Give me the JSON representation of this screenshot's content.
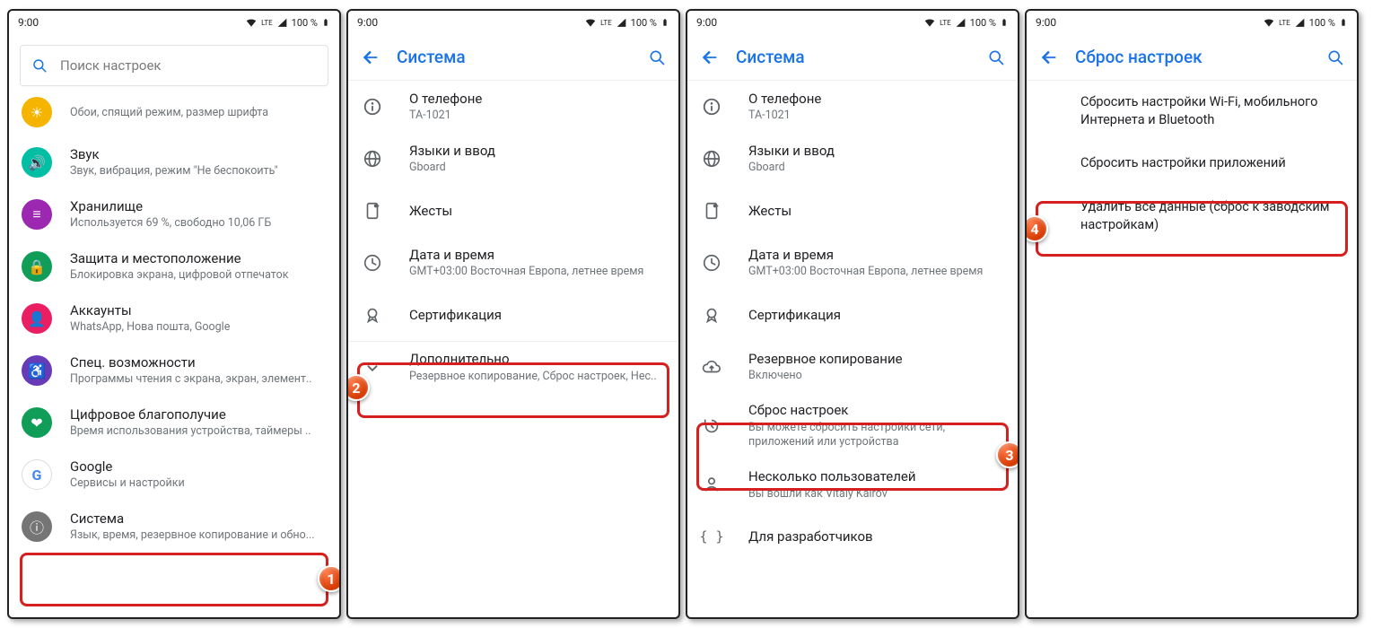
{
  "status": {
    "time": "9:00",
    "lte": "LTE",
    "battery": "100 %"
  },
  "screen1": {
    "search_placeholder": "Поиск настроек",
    "display": {
      "sub": "Обои, спящий режим, размер шрифта"
    },
    "sound": {
      "title": "Звук",
      "sub": "Звук, вибрация, режим \"Не беспокоить\""
    },
    "storage": {
      "title": "Хранилище",
      "sub": "Используется 69 %, свободно 10,06 ГБ"
    },
    "security": {
      "title": "Защита и местоположение",
      "sub": "Блокировка экрана, цифровой отпечаток"
    },
    "accounts": {
      "title": "Аккаунты",
      "sub": "WhatsApp, Нова пошта, Google"
    },
    "accessibility": {
      "title": "Спец. возможности",
      "sub": "Программы чтения с экрана, экран, элемент.."
    },
    "wellbeing": {
      "title": "Цифровое благополучие",
      "sub": "Время использования устройства, таймеры .."
    },
    "google": {
      "title": "Google",
      "sub": "Сервисы и настройки"
    },
    "system": {
      "title": "Система",
      "sub": "Язык, время, резервное копирование и обно..."
    }
  },
  "screen2": {
    "title": "Система",
    "about": {
      "title": "О телефоне",
      "sub": "TA-1021"
    },
    "lang": {
      "title": "Языки и ввод",
      "sub": "Gboard"
    },
    "gestures": {
      "title": "Жесты"
    },
    "datetime": {
      "title": "Дата и время",
      "sub": "GMT+03:00 Восточная Европа, летнее время"
    },
    "cert": {
      "title": "Сертификация"
    },
    "advanced": {
      "title": "Дополнительно",
      "sub": "Резервное копирование, Сброс настроек, Нес.."
    }
  },
  "screen3": {
    "title": "Система",
    "about": {
      "title": "О телефоне",
      "sub": "TA-1021"
    },
    "lang": {
      "title": "Языки и ввод",
      "sub": "Gboard"
    },
    "gestures": {
      "title": "Жесты"
    },
    "datetime": {
      "title": "Дата и время",
      "sub": "GMT+03:00 Восточная Европа, летнее время"
    },
    "cert": {
      "title": "Сертификация"
    },
    "backup": {
      "title": "Резервное копирование",
      "sub": "Включено"
    },
    "reset": {
      "title": "Сброс настроек",
      "sub": "Вы можете сбросить настройки сети,\nприложений или устройства"
    },
    "users": {
      "title": "Несколько пользователей",
      "sub": "Вы вошли как Vitaly Kairov"
    },
    "dev": {
      "title": "Для разработчиков"
    }
  },
  "screen4": {
    "title": "Сброс настроек",
    "wifi": "Сбросить настройки Wi-Fi, мобильного Интернета и Bluetooth",
    "apps": "Сбросить настройки приложений",
    "factory": "Удалить все данные (сброс к заводским настройкам)"
  },
  "badges": {
    "b1": "1",
    "b2": "2",
    "b3": "3",
    "b4": "4"
  }
}
